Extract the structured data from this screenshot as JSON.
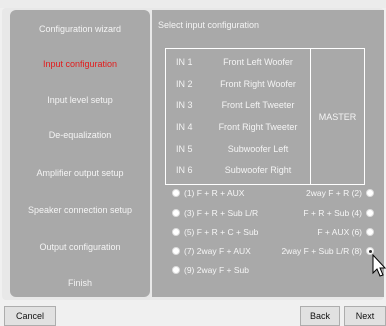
{
  "sidebar": {
    "items": [
      {
        "label": "Configuration wizard"
      },
      {
        "label": "Input configuration"
      },
      {
        "label": "Input level setup"
      },
      {
        "label": "De-equalization"
      },
      {
        "label": "Amplifier output setup"
      },
      {
        "label": "Speaker connection setup"
      },
      {
        "label": "Output configuration"
      },
      {
        "label": "Finish"
      }
    ]
  },
  "main": {
    "title": "Select input configuration",
    "channels": [
      {
        "input": "IN 1",
        "name": "Front Left Woofer"
      },
      {
        "input": "IN 2",
        "name": "Front Right Woofer"
      },
      {
        "input": "IN 3",
        "name": "Front Left Tweeter"
      },
      {
        "input": "IN 4",
        "name": "Front Right Tweeter"
      },
      {
        "input": "IN 5",
        "name": "Subwoofer Left"
      },
      {
        "input": "IN 6",
        "name": "Subwoofer Right"
      }
    ],
    "master_label": "MASTER",
    "options_left": [
      {
        "label": "(1) F + R + AUX"
      },
      {
        "label": "(3) F + R + Sub L/R"
      },
      {
        "label": "(5) F + R + C + Sub"
      },
      {
        "label": "(7) 2way F + AUX"
      },
      {
        "label": "(9) 2way F + Sub"
      }
    ],
    "options_right": [
      {
        "label": "2way F + R (2)"
      },
      {
        "label": "F + R + Sub (4)"
      },
      {
        "label": "F + AUX (6)"
      },
      {
        "label": "2way F + Sub L/R (8)"
      }
    ],
    "selected_option": "2way F + Sub L/R (8)"
  },
  "footer": {
    "cancel_label": "Cancel",
    "back_label": "Back",
    "next_label": "Next"
  }
}
